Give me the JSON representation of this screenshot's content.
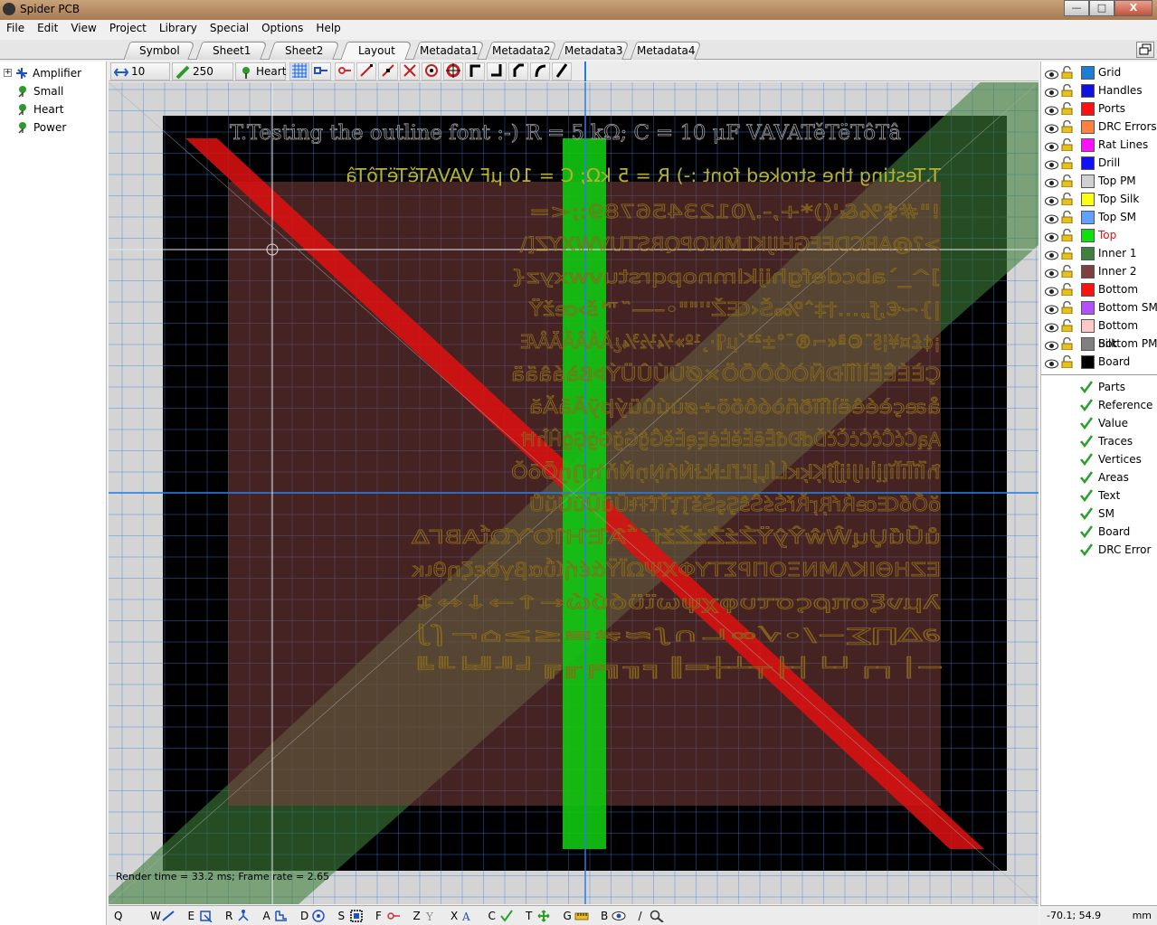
{
  "window": {
    "title": "Spider PCB",
    "minimize_label": "—",
    "maximize_label": "□",
    "close_label": "X"
  },
  "menu": [
    "File",
    "Edit",
    "View",
    "Project",
    "Library",
    "Special",
    "Options",
    "Help"
  ],
  "tabs": [
    "Symbol",
    "Sheet1",
    "Sheet2",
    "Layout",
    "Metadata1",
    "Metadata2",
    "Metadata3",
    "Metadata4"
  ],
  "active_tab": "Layout",
  "tree": {
    "root": "Amplifier",
    "children": [
      "Small",
      "Heart",
      "Power"
    ]
  },
  "toolbar": {
    "grid_value": "10 mm",
    "track_width": "250 μm",
    "part_name": "Heart"
  },
  "canvas": {
    "outline_text": "T.Testing the outline font :-) R = 5 kΩ; C = 10 μF VAVATěTëTôTâ",
    "stroked_text": "T.Testing the stroked font :-) R = 5 kΩ; C = 10 μF VAVATěTëTôTâ",
    "glyph_rows": [
      " !\"#$%&'()*+,-./0123456789:;<=",
      ">?@ABCDEFGHIJKLMNOPQRSTUVWXYZ[\\",
      "]^_`abcdefghijklmnopqrstuvwxyz{",
      "|}~€‚ƒ„…†‡ˆ‰Š‹ŒŽ''\"\"•–—˜™š›œžŸ",
      "¡¢£¤¥¦§¨©ª«¬®¯°±²³´µ¶·¸¹º»¼½¾¿ÀÁÂÃÄÅÆ",
      "ÇÈÉÊËÌÍÎÏÐÑÒÓÔÕÖ×ØÙÚÛÜÝÞßàáâãä",
      "åæçèéêëìíîïðñòóôõö÷øùúûüýþÿĀāĂă",
      "ĄąĆćĈĉĊċČčĎďĐđĒēĔĕĖėĘęĚěĜĝĞğĠġĢģĤĥĦ",
      "ħĨĩĪīĬĭĮįİıĲĳĴĵĶķĸĹĺĻļĽľĿŀŁłŃńŅņŇňŉŊŋŌōŎ",
      "ŏŐőŒœŔŕŖŗŘřŚśŜŝŞşŠšŢţŤťŦŧŨũŪūŬŭŮ",
      "ůŰűŲųŴŵŶŷŸŹźŻżŽžſ΄΅ΆΈΉΊΌΎΏΐΑΒΓΔ",
      "ΕΖΗΘΙΚΛΜΝΞΟΠΡΣΤΥΦΧΨΩΪΫάέήίΰαβγδεζηθικ",
      "λμνξοπρςστυφχψωϊϋόύώ←↑→↓↔↕",
      "∂∆∏∑−∕∙√∞∟∩∫≈≠≡≤≥⌂⌐⌠⌡",
      "─│┌┐└┘├┤┬┴┼═║╒╓╔╕╖╗╘╙╚╛╜╝"
    ],
    "render_stats": "Render time = 33.2 ms; Frame rate = 2.65"
  },
  "layers": [
    {
      "name": "Grid",
      "color": "#1c7cd6"
    },
    {
      "name": "Handles",
      "color": "#1010e0"
    },
    {
      "name": "Ports",
      "color": "#ff1010"
    },
    {
      "name": "DRC Errors",
      "color": "#ff8040"
    },
    {
      "name": "Rat Lines",
      "color": "#ff10ff"
    },
    {
      "name": "Drill",
      "color": "#1010ff"
    },
    {
      "name": "Top PM",
      "color": "#d0d0d0"
    },
    {
      "name": "Top Silk",
      "color": "#ffff10"
    },
    {
      "name": "Top SM",
      "color": "#60a0ff"
    },
    {
      "name": "Top",
      "color": "#10e010"
    },
    {
      "name": "Inner 1",
      "color": "#3f7f3f"
    },
    {
      "name": "Inner 2",
      "color": "#7f3f3f"
    },
    {
      "name": "Bottom",
      "color": "#ff1010"
    },
    {
      "name": "Bottom SM",
      "color": "#b050ff"
    },
    {
      "name": "Bottom Silk",
      "color": "#ffc8c8"
    },
    {
      "name": "Bottom PM",
      "color": "#808080"
    },
    {
      "name": "Board",
      "color": "#000000"
    }
  ],
  "active_layer": "Top",
  "visibility": [
    "Parts",
    "Reference",
    "Value",
    "Traces",
    "Vertices",
    "Areas",
    "Text",
    "SM",
    "Board",
    "DRC Error"
  ],
  "bottom_tools": [
    {
      "key": "Q",
      "icon": "none"
    },
    {
      "key": "W",
      "icon": "wire-icon"
    },
    {
      "key": "E",
      "icon": "edit-icon"
    },
    {
      "key": "R",
      "icon": "route-icon"
    },
    {
      "key": "A",
      "icon": "area-icon"
    },
    {
      "key": "D",
      "icon": "drill-icon"
    },
    {
      "key": "S",
      "icon": "select-icon"
    },
    {
      "key": "F",
      "icon": "pin-icon"
    },
    {
      "key": "Z",
      "icon": "zoom-text-icon"
    },
    {
      "key": "X",
      "icon": "text-icon"
    },
    {
      "key": "C",
      "icon": "check-icon"
    },
    {
      "key": "T",
      "icon": "move-icon"
    },
    {
      "key": "G",
      "icon": "measure-icon"
    },
    {
      "key": "B",
      "icon": "view-icon"
    },
    {
      "key": "/",
      "icon": "magnifier-icon"
    }
  ],
  "status": {
    "coords": "-70.1; 54.9",
    "units": "mm"
  }
}
